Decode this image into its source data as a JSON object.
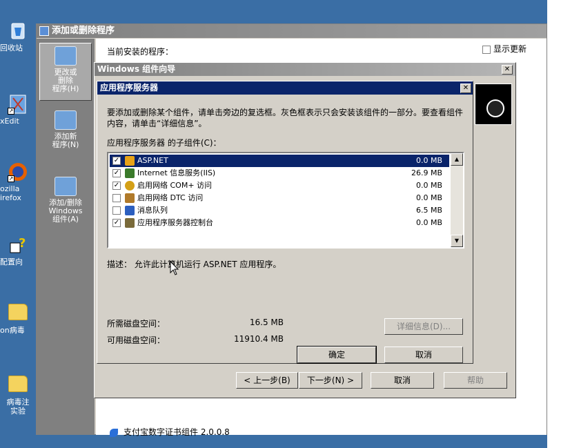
{
  "desktop": {
    "icons": [
      {
        "label": "回收站",
        "icon": "recycle-bin-icon"
      },
      {
        "label": "xEdit",
        "icon": "editor-icon"
      },
      {
        "label": "ozilla\nirefox",
        "icon": "firefox-icon"
      },
      {
        "label": "配置向",
        "icon": "config-wizard-icon"
      },
      {
        "label": "on病毒",
        "icon": "folder-icon"
      },
      {
        "label": "病毒注\n实验",
        "icon": "folder-icon"
      }
    ]
  },
  "arp_window": {
    "title": "添加或删除程序",
    "sidebar": [
      {
        "label": "更改或\n删除\n程序(H)",
        "active": true
      },
      {
        "label": "添加新\n程序(N)",
        "active": false
      },
      {
        "label": "添加/删除\nWindows\n组件(A)",
        "active": false
      }
    ],
    "header_text": "当前安装的程序：",
    "show_updates_label": "显示更新",
    "list_entry": "支付宝数字证书组件 2.0.0.8"
  },
  "wizard": {
    "title": "Windows 组件向导",
    "close_label": "✕",
    "buttons": {
      "back": "< 上一步(B)",
      "next": "下一步(N) >",
      "cancel": "取消",
      "help": "帮助"
    }
  },
  "dialog": {
    "title": "应用程序服务器",
    "close_label": "✕",
    "instructions": "要添加或删除某个组件，请单击旁边的复选框。灰色框表示只会安装该组件的一部分。要查看组件内容，请单击“详细信息”。",
    "sub_label": "应用程序服务器 的子组件(C)：",
    "components": [
      {
        "name": "ASP.NET",
        "size": "0.0 MB",
        "checked": true,
        "selected": true,
        "icon_color": "#e8a317"
      },
      {
        "name": "Internet 信息服务(IIS)",
        "size": "26.9 MB",
        "checked": true,
        "selected": false,
        "icon_color": "#3a7a2a"
      },
      {
        "name": "启用网络 COM+ 访问",
        "size": "0.0 MB",
        "checked": true,
        "selected": false,
        "icon_color": "#d4a017"
      },
      {
        "name": "启用网络 DTC 访问",
        "size": "0.0 MB",
        "checked": false,
        "selected": false,
        "icon_color": "#b07a2a"
      },
      {
        "name": "消息队列",
        "size": "6.5 MB",
        "checked": false,
        "selected": false,
        "icon_color": "#2c5fbf"
      },
      {
        "name": "应用程序服务器控制台",
        "size": "0.0 MB",
        "checked": true,
        "selected": false,
        "icon_color": "#7a6a3a"
      }
    ],
    "check_mark": "✓",
    "description": "描述：  允许此计算机运行 ASP.NET 应用程序。",
    "required_space_label": "所需磁盘空间：",
    "required_space_value": "16.5 MB",
    "available_space_label": "可用磁盘空间：",
    "available_space_value": "11910.4 MB",
    "details_button": "详细信息(D)...",
    "ok_button": "确定",
    "cancel_button": "取消"
  }
}
